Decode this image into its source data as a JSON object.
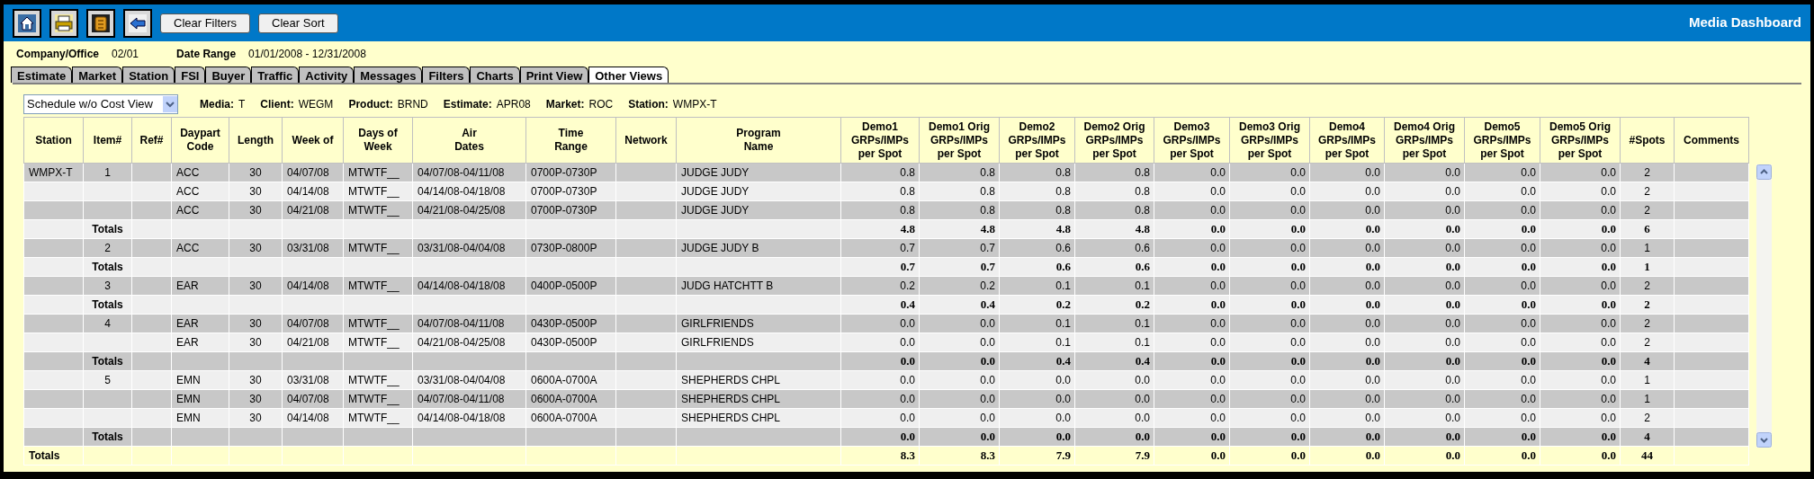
{
  "toolbar": {
    "icon_buttons": [
      {
        "kind": "home"
      },
      {
        "kind": "print"
      },
      {
        "kind": "money"
      },
      {
        "kind": "back"
      }
    ],
    "buttons": [
      "Clear Filters",
      "Clear Sort"
    ],
    "title": "Media Dashboard"
  },
  "info": [
    {
      "label": "Company/Office",
      "value": "02/01"
    },
    {
      "label": "Date Range",
      "value": "01/01/2008 - 12/31/2008"
    }
  ],
  "tabs": [
    {
      "label": "Estimate",
      "selected": false
    },
    {
      "label": "Market",
      "selected": false
    },
    {
      "label": "Station",
      "selected": false
    },
    {
      "label": "FSI",
      "selected": false
    },
    {
      "label": "Buyer",
      "selected": false
    },
    {
      "label": "Traffic",
      "selected": false
    },
    {
      "label": "Activity",
      "selected": false
    },
    {
      "label": "Messages",
      "selected": false
    },
    {
      "label": "Filters",
      "selected": false
    },
    {
      "label": "Charts",
      "selected": false
    },
    {
      "label": "Print View",
      "selected": false
    },
    {
      "label": "Other Views",
      "selected": true
    }
  ],
  "view_select": {
    "value": "Schedule w/o Cost View"
  },
  "filters": [
    {
      "label": "Media:",
      "value": "T"
    },
    {
      "label": "Client:",
      "value": "WEGM"
    },
    {
      "label": "Product:",
      "value": "BRND"
    },
    {
      "label": "Estimate:",
      "value": "APR08"
    },
    {
      "label": "Market:",
      "value": "ROC"
    },
    {
      "label": "Station:",
      "value": "WMPX-T"
    }
  ],
  "table": {
    "columns": [
      "Station",
      "Item#",
      "Ref#",
      "Daypart\nCode",
      "Length",
      "Week of",
      "Days of\nWeek",
      "Air\nDates",
      "Time\nRange",
      "Network",
      "Program\nName",
      "Demo1\nGRPs/IMPs\nper Spot",
      "Demo1 Orig\nGRPs/IMPs\nper Spot",
      "Demo2\nGRPs/IMPs\nper Spot",
      "Demo2 Orig\nGRPs/IMPs\nper Spot",
      "Demo3\nGRPs/IMPs\nper Spot",
      "Demo3 Orig\nGRPs/IMPs\nper Spot",
      "Demo4\nGRPs/IMPs\nper Spot",
      "Demo4 Orig\nGRPs/IMPs\nper Spot",
      "Demo5\nGRPs/IMPs\nper Spot",
      "Demo5 Orig\nGRPs/IMPs\nper Spot",
      "#Spots",
      "Comments"
    ],
    "rows": [
      {
        "kind": "item",
        "station": "WMPX-T",
        "item": "1",
        "daypart": "ACC",
        "length": "30",
        "week_of": "04/07/08",
        "days": "MTWTF__",
        "air_dates": "04/07/08-04/11/08",
        "time_range": "0700P-0730P",
        "program": "JUDGE JUDY",
        "demos": [
          "0.8",
          "0.8",
          "0.8",
          "0.8",
          "0.0",
          "0.0",
          "0.0",
          "0.0",
          "0.0",
          "0.0"
        ],
        "spots": "2"
      },
      {
        "kind": "item",
        "daypart": "ACC",
        "length": "30",
        "week_of": "04/14/08",
        "days": "MTWTF__",
        "air_dates": "04/14/08-04/18/08",
        "time_range": "0700P-0730P",
        "program": "JUDGE JUDY",
        "demos": [
          "0.8",
          "0.8",
          "0.8",
          "0.8",
          "0.0",
          "0.0",
          "0.0",
          "0.0",
          "0.0",
          "0.0"
        ],
        "spots": "2"
      },
      {
        "kind": "item",
        "daypart": "ACC",
        "length": "30",
        "week_of": "04/21/08",
        "days": "MTWTF__",
        "air_dates": "04/21/08-04/25/08",
        "time_range": "0700P-0730P",
        "program": "JUDGE JUDY",
        "demos": [
          "0.8",
          "0.8",
          "0.8",
          "0.8",
          "0.0",
          "0.0",
          "0.0",
          "0.0",
          "0.0",
          "0.0"
        ],
        "spots": "2"
      },
      {
        "kind": "subtotal",
        "label": "Totals",
        "demos": [
          "4.8",
          "4.8",
          "4.8",
          "4.8",
          "0.0",
          "0.0",
          "0.0",
          "0.0",
          "0.0",
          "0.0"
        ],
        "spots": "6"
      },
      {
        "kind": "item",
        "item": "2",
        "daypart": "ACC",
        "length": "30",
        "week_of": "03/31/08",
        "days": "MTWTF__",
        "air_dates": "03/31/08-04/04/08",
        "time_range": "0730P-0800P",
        "program": "JUDGE JUDY B",
        "demos": [
          "0.7",
          "0.7",
          "0.6",
          "0.6",
          "0.0",
          "0.0",
          "0.0",
          "0.0",
          "0.0",
          "0.0"
        ],
        "spots": "1"
      },
      {
        "kind": "subtotal",
        "label": "Totals",
        "demos": [
          "0.7",
          "0.7",
          "0.6",
          "0.6",
          "0.0",
          "0.0",
          "0.0",
          "0.0",
          "0.0",
          "0.0"
        ],
        "spots": "1"
      },
      {
        "kind": "item",
        "item": "3",
        "daypart": "EAR",
        "length": "30",
        "week_of": "04/14/08",
        "days": "MTWTF__",
        "air_dates": "04/14/08-04/18/08",
        "time_range": "0400P-0500P",
        "program": "JUDG HATCHTT B",
        "demos": [
          "0.2",
          "0.2",
          "0.1",
          "0.1",
          "0.0",
          "0.0",
          "0.0",
          "0.0",
          "0.0",
          "0.0"
        ],
        "spots": "2"
      },
      {
        "kind": "subtotal",
        "label": "Totals",
        "demos": [
          "0.4",
          "0.4",
          "0.2",
          "0.2",
          "0.0",
          "0.0",
          "0.0",
          "0.0",
          "0.0",
          "0.0"
        ],
        "spots": "2"
      },
      {
        "kind": "item",
        "item": "4",
        "daypart": "EAR",
        "length": "30",
        "week_of": "04/07/08",
        "days": "MTWTF__",
        "air_dates": "04/07/08-04/11/08",
        "time_range": "0430P-0500P",
        "program": "GIRLFRIENDS",
        "demos": [
          "0.0",
          "0.0",
          "0.1",
          "0.1",
          "0.0",
          "0.0",
          "0.0",
          "0.0",
          "0.0",
          "0.0"
        ],
        "spots": "2"
      },
      {
        "kind": "item",
        "daypart": "EAR",
        "length": "30",
        "week_of": "04/21/08",
        "days": "MTWTF__",
        "air_dates": "04/21/08-04/25/08",
        "time_range": "0430P-0500P",
        "program": "GIRLFRIENDS",
        "demos": [
          "0.0",
          "0.0",
          "0.1",
          "0.1",
          "0.0",
          "0.0",
          "0.0",
          "0.0",
          "0.0",
          "0.0"
        ],
        "spots": "2"
      },
      {
        "kind": "subtotal",
        "label": "Totals",
        "demos": [
          "0.0",
          "0.0",
          "0.4",
          "0.4",
          "0.0",
          "0.0",
          "0.0",
          "0.0",
          "0.0",
          "0.0"
        ],
        "spots": "4"
      },
      {
        "kind": "item",
        "item": "5",
        "daypart": "EMN",
        "length": "30",
        "week_of": "03/31/08",
        "days": "MTWTF__",
        "air_dates": "03/31/08-04/04/08",
        "time_range": "0600A-0700A",
        "program": "SHEPHERDS CHPL",
        "demos": [
          "0.0",
          "0.0",
          "0.0",
          "0.0",
          "0.0",
          "0.0",
          "0.0",
          "0.0",
          "0.0",
          "0.0"
        ],
        "spots": "1"
      },
      {
        "kind": "item",
        "daypart": "EMN",
        "length": "30",
        "week_of": "04/07/08",
        "days": "MTWTF__",
        "air_dates": "04/07/08-04/11/08",
        "time_range": "0600A-0700A",
        "program": "SHEPHERDS CHPL",
        "demos": [
          "0.0",
          "0.0",
          "0.0",
          "0.0",
          "0.0",
          "0.0",
          "0.0",
          "0.0",
          "0.0",
          "0.0"
        ],
        "spots": "1"
      },
      {
        "kind": "item",
        "daypart": "EMN",
        "length": "30",
        "week_of": "04/14/08",
        "days": "MTWTF__",
        "air_dates": "04/14/08-04/18/08",
        "time_range": "0600A-0700A",
        "program": "SHEPHERDS CHPL",
        "demos": [
          "0.0",
          "0.0",
          "0.0",
          "0.0",
          "0.0",
          "0.0",
          "0.0",
          "0.0",
          "0.0",
          "0.0"
        ],
        "spots": "2"
      },
      {
        "kind": "subtotal",
        "label": "Totals",
        "demos": [
          "0.0",
          "0.0",
          "0.0",
          "0.0",
          "0.0",
          "0.0",
          "0.0",
          "0.0",
          "0.0",
          "0.0"
        ],
        "spots": "4"
      }
    ],
    "grand_total": {
      "label": "Totals",
      "demos": [
        "8.3",
        "8.3",
        "7.9",
        "7.9",
        "0.0",
        "0.0",
        "0.0",
        "0.0",
        "0.0",
        "0.0"
      ],
      "spots": "44"
    }
  }
}
